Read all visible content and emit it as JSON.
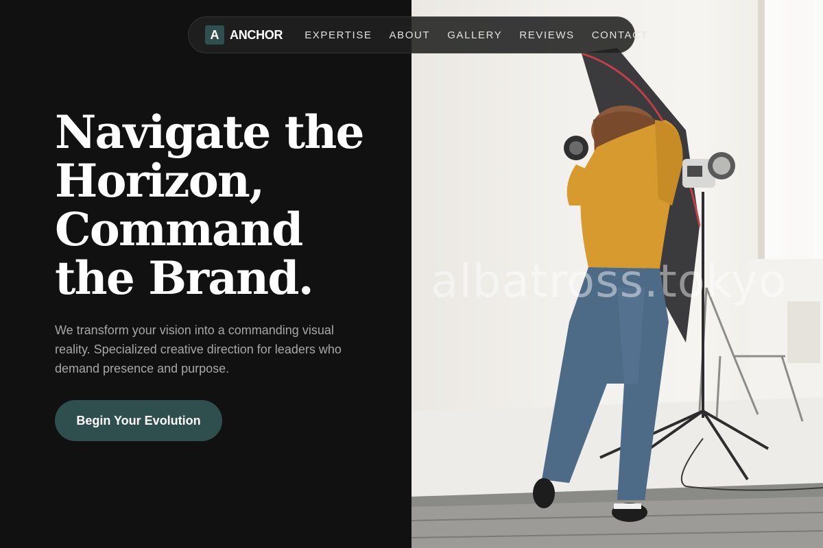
{
  "brand": {
    "mark": "A",
    "name": "ANCHOR",
    "accent_color": "#2f4f4f"
  },
  "nav": {
    "links": [
      "EXPERTISE",
      "ABOUT",
      "GALLERY",
      "REVIEWS",
      "CONTACT"
    ]
  },
  "hero": {
    "headline_lines": [
      "Navigate the",
      "Horizon,",
      "Command",
      "the Brand."
    ],
    "subtitle": "We transform your vision into a commanding visual reality. Specialized creative direction for leaders who demand presence and purpose.",
    "cta_label": "Begin Your Evolution",
    "watermark": "albatross.tokyo"
  },
  "colors": {
    "background": "#111111",
    "text_primary": "#ffffff",
    "text_muted": "#a7a7a7",
    "button": "#2f4f4f"
  }
}
